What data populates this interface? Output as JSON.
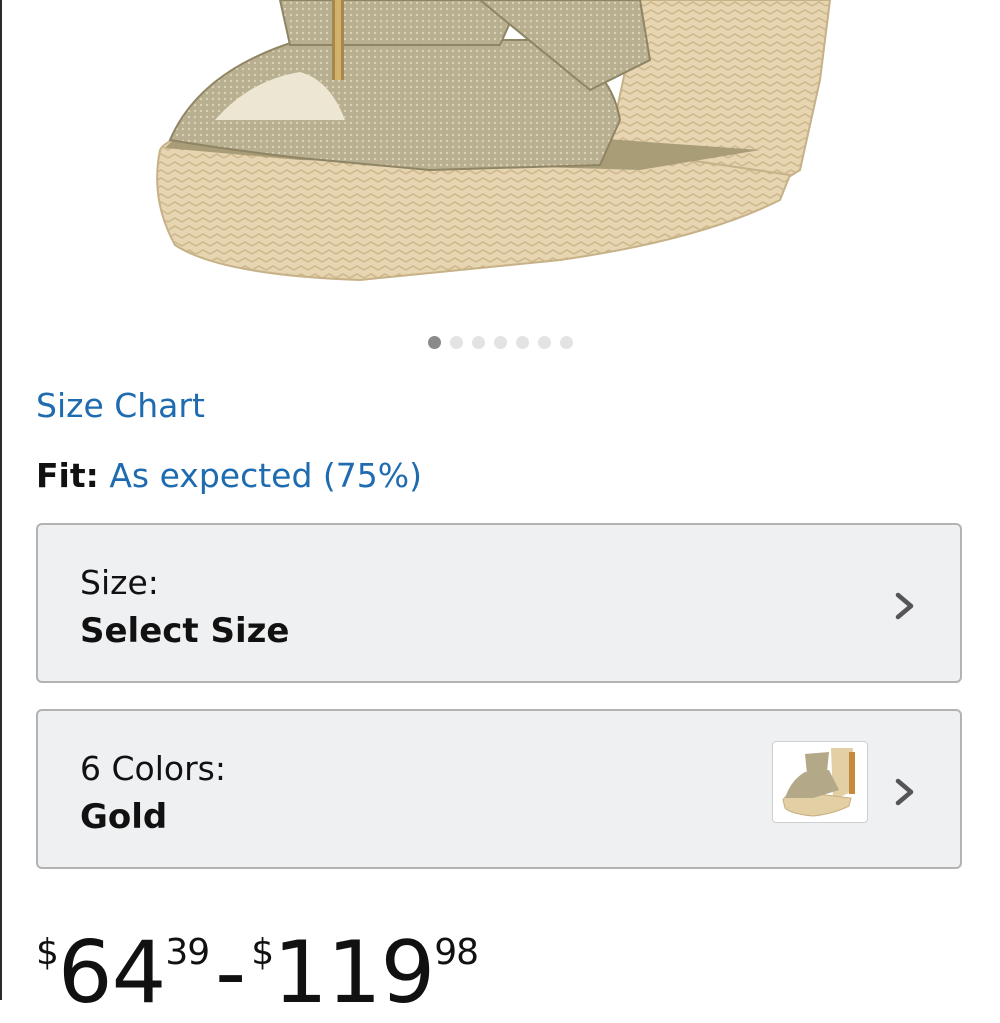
{
  "carousel": {
    "count": 7,
    "active_index": 0
  },
  "size_chart_link": "Size Chart",
  "fit": {
    "label": "Fit:",
    "value": "As expected (75%)"
  },
  "size_selector": {
    "label": "Size:",
    "value": "Select Size"
  },
  "color_selector": {
    "label": "6 Colors:",
    "value": "Gold"
  },
  "price": {
    "currency": "$",
    "low_dollars": "64",
    "low_cents": "39",
    "separator": "-",
    "high_dollars": "119",
    "high_cents": "98"
  },
  "colors": {
    "link": "#1f6bb0",
    "selector_bg": "#eff0f2",
    "selector_border": "#b3b3b3"
  },
  "icons": {
    "chevron": "chevron-right-icon",
    "product": "wedge-sandal-image"
  }
}
